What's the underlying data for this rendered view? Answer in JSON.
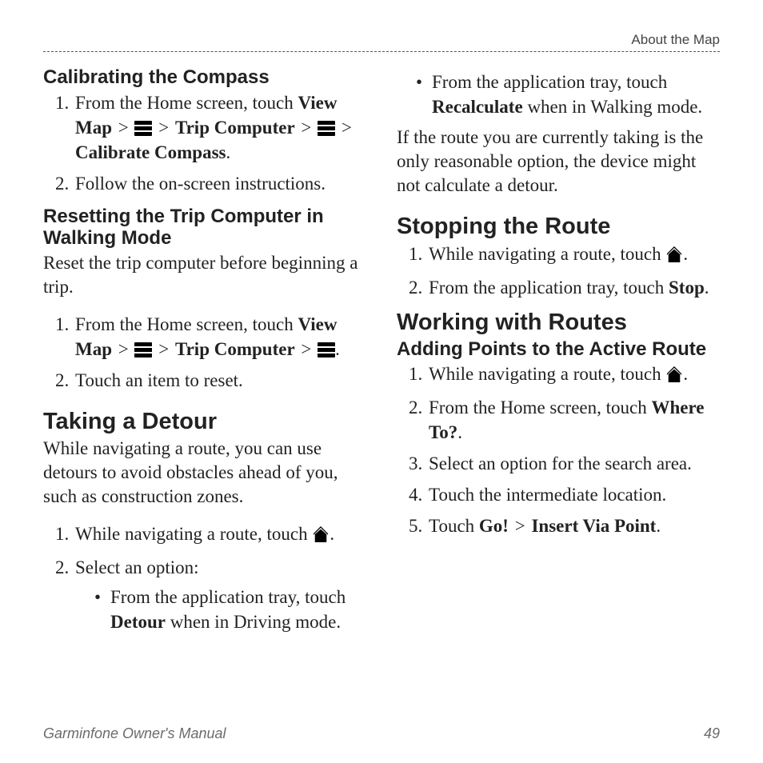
{
  "running_head": "About the Map",
  "footer": {
    "title": "Garminfone Owner's Manual",
    "page": "49"
  },
  "left": {
    "compass": {
      "heading": "Calibrating the Compass",
      "s1_a": "From the Home screen, touch ",
      "s1_view_map": "View Map",
      "s1_trip": "Trip Computer",
      "s1_cal": "Calibrate Compass",
      "s2": "Follow the on-screen instructions."
    },
    "reset": {
      "heading": "Resetting the Trip Computer in Walking Mode",
      "intro": "Reset the trip computer before beginning a trip.",
      "s1_a": "From the Home screen, touch ",
      "s1_view_map": "View Map",
      "s1_trip": "Trip Computer",
      "s2": "Touch an item to reset."
    },
    "detour": {
      "heading": "Taking a Detour",
      "intro": "While navigating a route, you can use detours to avoid obstacles ahead of you, such as construction zones.",
      "s1": "While navigating a route, touch ",
      "s2": "Select an option:",
      "b1_a": "From the application tray, touch ",
      "b1_bold": "Detour",
      "b1_b": " when in Driving mode."
    }
  },
  "right": {
    "detour_cont": {
      "b2_a": "From the application tray, touch ",
      "b2_bold": "Recalculate",
      "b2_b": " when in Walking mode.",
      "note": "If the route you are currently taking is the only reasonable option, the device might not calculate a detour."
    },
    "stop": {
      "heading": "Stopping the Route",
      "s1": "While navigating a route, touch ",
      "s2_a": "From the application tray, touch ",
      "s2_bold": "Stop"
    },
    "working": {
      "heading": "Working with Routes",
      "sub": "Adding Points to the Active Route",
      "s1": "While navigating a route, touch ",
      "s2_a": "From the Home screen, touch ",
      "s2_bold": "Where To?",
      "s3": "Select an option for the search area.",
      "s4": "Touch the intermediate location.",
      "s5_a": "Touch ",
      "s5_go": "Go!",
      "s5_via": "Insert Via Point"
    }
  }
}
